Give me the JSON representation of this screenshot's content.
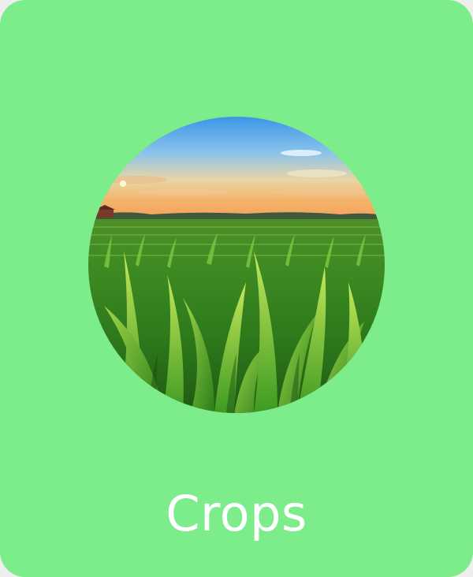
{
  "card": {
    "label": "Crops",
    "image_subject": "cornfield-at-sunset",
    "background_color": "#7ced8a",
    "label_color": "#ffffff"
  }
}
